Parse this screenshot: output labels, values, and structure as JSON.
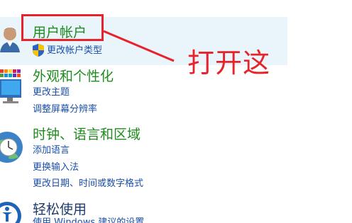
{
  "user_accounts": {
    "title": "用户帐户",
    "links": [
      "更改帐户类型"
    ]
  },
  "appearance": {
    "title": "外观和个性化",
    "links": [
      "更改主题",
      "调整屏幕分辨率"
    ]
  },
  "clock_region": {
    "title": "时钟、语言和区域",
    "links": [
      "添加语言",
      "更换输入法",
      "更改日期、时间或数字格式"
    ]
  },
  "ease_of_access": {
    "title": "轻松使用",
    "partial_link": "使用 Windows 建议的设置"
  },
  "annotation": {
    "text": "打开这",
    "color": "#e8222a"
  },
  "colors": {
    "category_green": "#1e8c1e",
    "link_blue": "#1b4fa8",
    "highlight_bg": "#eaf4fb"
  }
}
